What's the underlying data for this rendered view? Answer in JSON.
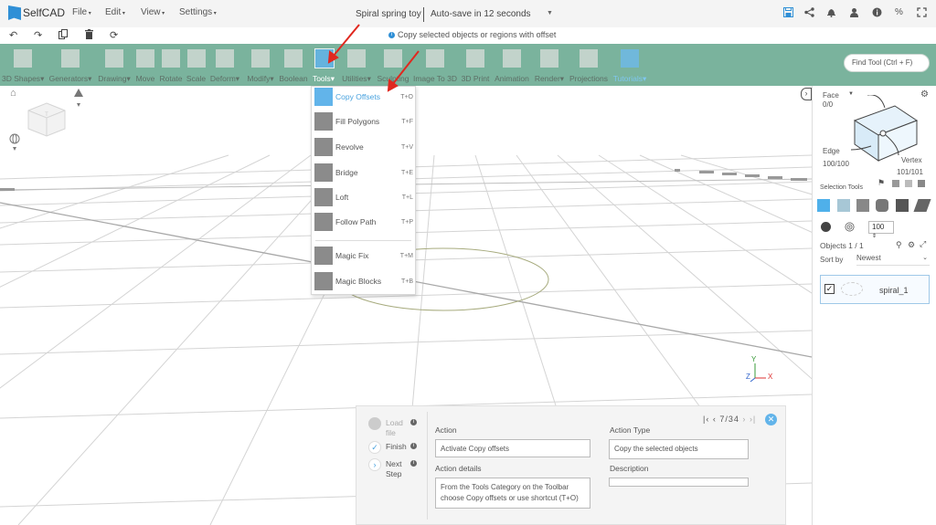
{
  "app": {
    "name": "SelfCAD",
    "doc_title": "Spiral spring toy",
    "autosave": "Auto-save in 12 seconds"
  },
  "menu": [
    {
      "label": "File",
      "icon": "chevron-down-icon"
    },
    {
      "label": "Edit",
      "icon": "chevron-down-icon"
    },
    {
      "label": "View",
      "icon": "chevron-down-icon"
    },
    {
      "label": "Settings",
      "icon": "chevron-down-icon"
    }
  ],
  "top_icons": [
    "save-icon",
    "share-icon",
    "bell-icon",
    "user-icon",
    "info-icon",
    "percent-icon",
    "expand-icon"
  ],
  "sub_icons": [
    "undo-icon",
    "redo-icon",
    "copy-icon",
    "trash-icon",
    "refresh-icon"
  ],
  "hint": "Copy selected objects or regions with offset",
  "toolbar": {
    "tools": [
      {
        "label": "3D Shapes",
        "dropdown": true
      },
      {
        "label": "Generators",
        "dropdown": true
      },
      {
        "label": "Drawing",
        "dropdown": true
      },
      {
        "label": "Move",
        "dropdown": false
      },
      {
        "label": "Rotate",
        "dropdown": false
      },
      {
        "label": "Scale",
        "dropdown": false
      },
      {
        "label": "Deform",
        "dropdown": true
      },
      {
        "label": "Modify",
        "dropdown": true
      },
      {
        "label": "Boolean",
        "dropdown": false
      },
      {
        "label": "Tools",
        "dropdown": true
      },
      {
        "label": "Utilities",
        "dropdown": true
      },
      {
        "label": "Sculpting",
        "dropdown": false
      },
      {
        "label": "Image To 3D",
        "dropdown": false
      },
      {
        "label": "3D Print",
        "dropdown": false
      },
      {
        "label": "Animation",
        "dropdown": false
      },
      {
        "label": "Render",
        "dropdown": true
      },
      {
        "label": "Projections",
        "dropdown": false
      },
      {
        "label": "Tutorials",
        "dropdown": true
      }
    ],
    "active_tool": "Tools",
    "find_placeholder": "Find Tool (Ctrl + F)"
  },
  "tools_dropdown": [
    {
      "label": "Copy Offsets",
      "shortcut": "T+O",
      "selected": true
    },
    {
      "label": "Fill Polygons",
      "shortcut": "T+F"
    },
    {
      "label": "Revolve",
      "shortcut": "T+V"
    },
    {
      "label": "Bridge",
      "shortcut": "T+E"
    },
    {
      "label": "Loft",
      "shortcut": "T+L"
    },
    {
      "label": "Follow Path",
      "shortcut": "T+P"
    },
    {
      "label": "Magic Fix",
      "shortcut": "T+M"
    },
    {
      "label": "Magic Blocks",
      "shortcut": "T+B"
    }
  ],
  "right_panel": {
    "face_label": "Face",
    "face_count": "0/0",
    "edge_label": "Edge",
    "edge_count": "100/100",
    "vertex_label": "Vertex",
    "vertex_count": "101/101",
    "selection_tools_label": "Selection Tools",
    "brush_size": "100",
    "objects_label": "Objects 1 / 1",
    "sort_by_label": "Sort by",
    "sort_by_value": "Newest",
    "object_name": "spiral_1"
  },
  "axis": {
    "x": "X",
    "y": "Y",
    "z": "Z"
  },
  "tutorial": {
    "steps": [
      {
        "label": "Load file",
        "state": "pending"
      },
      {
        "label": "Finish",
        "state": "done"
      },
      {
        "label": "Next Step",
        "state": "next"
      }
    ],
    "pager": "7/34",
    "action_label": "Action",
    "action_value": "Activate Copy offsets",
    "action_details_label": "Action details",
    "action_details_value": "From the Tools Category on the Toolbar choose Copy offsets or use shortcut  (T+O)",
    "action_type_label": "Action Type",
    "action_type_value": "Copy the selected objects",
    "description_label": "Description",
    "description_value": ""
  },
  "colors": {
    "toolbar_green": "#7ab39d",
    "accent_blue": "#4aa3df",
    "annotation_red": "#e0281f"
  }
}
